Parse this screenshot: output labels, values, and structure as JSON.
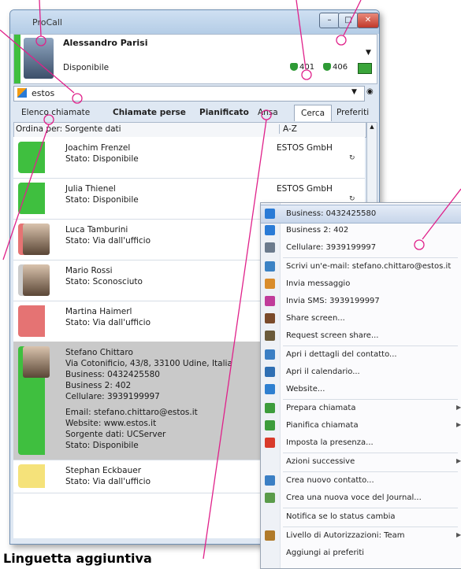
{
  "window": {
    "title": "ProCall"
  },
  "user": {
    "name": "Alessandro Parisi",
    "status": "Disponibile",
    "line1": "401",
    "line2": "406"
  },
  "search": {
    "value": "estos"
  },
  "tabs": [
    "Elenco chiamate",
    "Chiamate perse",
    "Pianificato",
    "Ansa",
    "Cerca",
    "Preferiti"
  ],
  "list_header": {
    "sort_label": "Ordina per: Sorgente dati",
    "sort_order": "A-Z"
  },
  "contacts": [
    {
      "name": "Joachim Frenzel",
      "lines": [
        "Stato: Disponibile"
      ],
      "company": "ESTOS GmbH",
      "status_color": "#3fbf3f"
    },
    {
      "name": "Julia Thienel",
      "lines": [
        "Stato: Disponibile"
      ],
      "company": "ESTOS GmbH",
      "status_color": "#3fbf3f"
    },
    {
      "name": "Luca Tamburini",
      "lines": [
        "Stato: Via dall'ufficio"
      ],
      "company": "",
      "status_color": "#e57373"
    },
    {
      "name": "Mario Rossi",
      "lines": [
        "Stato: Sconosciuto"
      ],
      "company": "",
      "status_color": "#cccccc"
    },
    {
      "name": "Martina Haimerl",
      "lines": [
        "Stato: Via dall'ufficio"
      ],
      "company": "",
      "status_color": "#e57373"
    },
    {
      "name": "Stefano Chittaro",
      "lines": [
        "Via Cotonificio, 43/8, 33100 Udine, Italia",
        "Business: 0432425580",
        "Business 2: 402",
        "Cellulare: 3939199997",
        "Email: stefano.chittaro@estos.it",
        "Website: www.estos.it",
        "Sorgente dati: UCServer",
        "Stato: Disponibile"
      ],
      "company": "",
      "status_color": "#3fbf3f"
    },
    {
      "name": "Stephan Eckbauer",
      "lines": [
        "Stato: Via dall'ufficio"
      ],
      "company": "",
      "status_color": "#f5e27a"
    }
  ],
  "context_menu": [
    {
      "label": "Business: 0432425580",
      "icon": "phone-card-icon"
    },
    {
      "label": "Business 2: 402",
      "icon": "phone-card-icon"
    },
    {
      "label": "Cellulare: 3939199997",
      "icon": "mobile-icon"
    },
    {
      "label": "Scrivi un'e-mail: stefano.chittaro@estos.it",
      "icon": "mail-icon"
    },
    {
      "label": "Invia messaggio",
      "icon": "chat-icon"
    },
    {
      "label": "Invia SMS: 3939199997",
      "icon": "sms-icon"
    },
    {
      "label": "Share screen...",
      "icon": "share-screen-icon"
    },
    {
      "label": "Request screen share...",
      "icon": "request-share-icon"
    },
    {
      "label": "Apri i dettagli del contatto...",
      "icon": "contact-card-icon"
    },
    {
      "label": "Apri il calendario...",
      "icon": "calendar-icon"
    },
    {
      "label": "Website...",
      "icon": "globe-icon"
    },
    {
      "label": "Prepara chiamata",
      "icon": "prepare-call-icon"
    },
    {
      "label": "Pianifica chiamata",
      "icon": "schedule-call-icon"
    },
    {
      "label": "Imposta la presenza...",
      "icon": "presence-icon"
    },
    {
      "label": "Azioni successive",
      "icon": ""
    },
    {
      "label": "Crea nuovo contatto...",
      "icon": "new-contact-icon"
    },
    {
      "label": "Crea una nuova voce del Journal...",
      "icon": "journal-icon"
    },
    {
      "label": "Notifica se lo status cambia",
      "icon": ""
    },
    {
      "label": "Livello di Autorizzazioni: Team",
      "icon": "team-icon"
    },
    {
      "label": "Aggiungi ai preferiti",
      "icon": ""
    }
  ],
  "caption": "Linguetta aggiuntiva",
  "colors": {
    "available": "#3fbf3f",
    "away": "#e57373",
    "annotation": "#e0218a"
  }
}
